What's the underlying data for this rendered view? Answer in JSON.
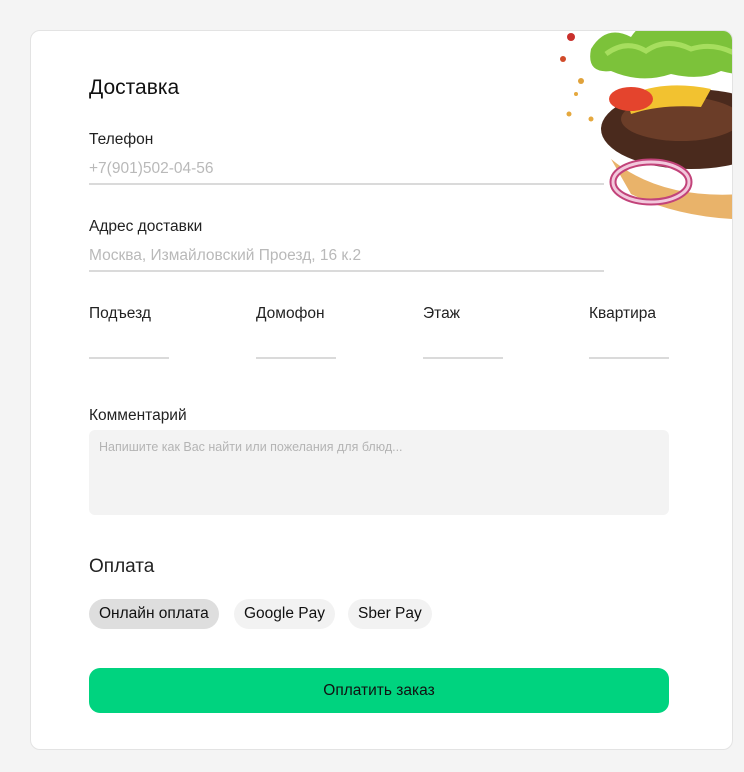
{
  "form": {
    "title": "Доставка",
    "phone": {
      "label": "Телефон",
      "value": "+7(901)502-04-56"
    },
    "address": {
      "label": "Адрес доставки",
      "value": "Москва, Измайловский Проезд, 16 к.2"
    },
    "entrance": {
      "label": "Подъезд",
      "value": ""
    },
    "intercom": {
      "label": "Домофон",
      "value": ""
    },
    "floor": {
      "label": "Этаж",
      "value": ""
    },
    "apartment": {
      "label": "Квартира",
      "value": ""
    },
    "comment": {
      "label": "Комментарий",
      "placeholder": "Напишите как Вас найти или пожелания для блюд..."
    }
  },
  "payment": {
    "title": "Оплата",
    "options": [
      {
        "label": "Онлайн оплата",
        "selected": true
      },
      {
        "label": "Google Pay",
        "selected": false
      },
      {
        "label": "Sber Pay",
        "selected": false
      }
    ]
  },
  "submit_label": "Оплатить заказ",
  "colors": {
    "accent": "#00d37f",
    "placeholder": "#b9b9b9",
    "background": "#f4f4f4",
    "card": "#ffffff"
  },
  "icons": {
    "decoration": "burger-illustration"
  }
}
